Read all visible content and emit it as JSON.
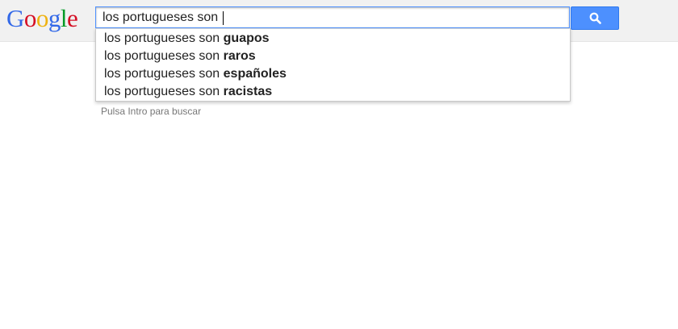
{
  "logo": {
    "text": "Google",
    "letters": [
      {
        "char": "G",
        "color": "#3369e8"
      },
      {
        "char": "o",
        "color": "#d50f25"
      },
      {
        "char": "o",
        "color": "#eeb211"
      },
      {
        "char": "g",
        "color": "#3369e8"
      },
      {
        "char": "l",
        "color": "#009925"
      },
      {
        "char": "e",
        "color": "#d50f25"
      }
    ]
  },
  "search": {
    "value": "los portugueses son ",
    "button_icon": "search-icon"
  },
  "suggestions": [
    {
      "prefix": "los portugueses son ",
      "completion": "guapos"
    },
    {
      "prefix": "los portugueses son ",
      "completion": "raros"
    },
    {
      "prefix": "los portugueses son ",
      "completion": "españoles"
    },
    {
      "prefix": "los portugueses son ",
      "completion": "racistas"
    }
  ],
  "hint": "Pulsa Intro para buscar",
  "colors": {
    "accent": "#4d90fe",
    "topbar": "#f1f1f1"
  }
}
